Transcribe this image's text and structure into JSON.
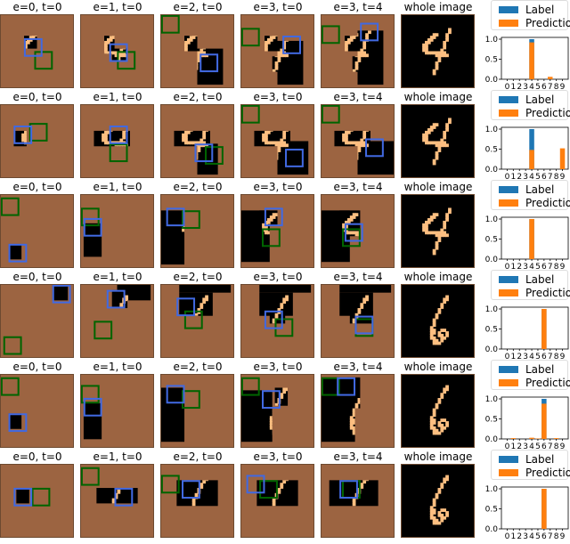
{
  "colors": {
    "canvas_brown": "#9c6441",
    "stroke_orange": "#fdbf81",
    "masked_black": "#000000",
    "glimpse_blue": "#4169e1",
    "glimpse_green": "#006400",
    "label_bar": "#1f77b4",
    "prediction_bar": "#ff7f0e"
  },
  "column_titles": [
    "e=0, t=0",
    "e=1, t=0",
    "e=2, t=0",
    "e=3, t=0",
    "e=3, t=4",
    "whole image"
  ],
  "legend": {
    "label": "Label",
    "prediction": "Prediction"
  },
  "rows": [
    {
      "digit": "4"
    },
    {
      "digit": "4"
    },
    {
      "digit": "4"
    },
    {
      "digit": "6"
    },
    {
      "digit": "6"
    },
    {
      "digit": "6"
    }
  ],
  "chart_data": [
    {
      "type": "bar",
      "title": "",
      "categories": [
        "0",
        "1",
        "2",
        "3",
        "4",
        "5",
        "6",
        "7",
        "8",
        "9"
      ],
      "series": [
        {
          "name": "Label",
          "values": [
            0,
            0,
            0,
            0,
            1,
            0,
            0,
            0,
            0,
            0
          ]
        },
        {
          "name": "Prediction",
          "values": [
            0,
            0,
            0,
            0,
            0.92,
            0,
            0,
            0.06,
            0,
            0
          ]
        }
      ],
      "ylim": [
        0,
        1.0
      ],
      "yticks": [
        "0.0",
        "0.5",
        "1.0"
      ],
      "legend": "top"
    },
    {
      "type": "bar",
      "title": "",
      "categories": [
        "0",
        "1",
        "2",
        "3",
        "4",
        "5",
        "6",
        "7",
        "8",
        "9"
      ],
      "series": [
        {
          "name": "Label",
          "values": [
            0,
            0,
            0,
            0,
            1,
            0,
            0,
            0,
            0,
            0
          ]
        },
        {
          "name": "Prediction",
          "values": [
            0,
            0,
            0,
            0,
            0.48,
            0,
            0,
            0,
            0,
            0.52
          ]
        }
      ],
      "ylim": [
        0,
        1.0
      ],
      "yticks": [
        "0.0",
        "0.5",
        "1.0"
      ],
      "legend": "top"
    },
    {
      "type": "bar",
      "title": "",
      "categories": [
        "0",
        "1",
        "2",
        "3",
        "4",
        "5",
        "6",
        "7",
        "8",
        "9"
      ],
      "series": [
        {
          "name": "Label",
          "values": [
            0,
            0,
            0,
            0,
            1,
            0,
            0,
            0,
            0,
            0
          ]
        },
        {
          "name": "Prediction",
          "values": [
            0,
            0,
            0,
            0,
            1.0,
            0,
            0,
            0,
            0,
            0
          ]
        }
      ],
      "ylim": [
        0,
        1.0
      ],
      "yticks": [
        "0.0",
        "0.5",
        "1.0"
      ],
      "legend": "top"
    },
    {
      "type": "bar",
      "title": "",
      "categories": [
        "0",
        "1",
        "2",
        "3",
        "4",
        "5",
        "6",
        "7",
        "8",
        "9"
      ],
      "series": [
        {
          "name": "Label",
          "values": [
            0,
            0,
            0,
            0,
            0,
            0,
            1,
            0,
            0,
            0
          ]
        },
        {
          "name": "Prediction",
          "values": [
            0,
            0,
            0,
            0,
            0,
            0,
            1.0,
            0,
            0,
            0
          ]
        }
      ],
      "ylim": [
        0,
        1.0
      ],
      "yticks": [
        "0.0",
        "0.5",
        "1.0"
      ],
      "legend": "top"
    },
    {
      "type": "bar",
      "title": "",
      "categories": [
        "0",
        "1",
        "2",
        "3",
        "4",
        "5",
        "6",
        "7",
        "8",
        "9"
      ],
      "series": [
        {
          "name": "Label",
          "values": [
            0,
            0,
            0,
            0,
            0,
            0,
            1,
            0,
            0,
            0
          ]
        },
        {
          "name": "Prediction",
          "values": [
            0,
            0.02,
            0,
            0,
            0.03,
            0.01,
            0.88,
            0,
            0.02,
            0
          ]
        }
      ],
      "ylim": [
        0,
        1.0
      ],
      "yticks": [
        "0.0",
        "0.5",
        "1.0"
      ],
      "legend": "top"
    },
    {
      "type": "bar",
      "title": "",
      "categories": [
        "0",
        "1",
        "2",
        "3",
        "4",
        "5",
        "6",
        "7",
        "8",
        "9"
      ],
      "series": [
        {
          "name": "Label",
          "values": [
            0,
            0,
            0,
            0,
            0,
            0,
            1,
            0,
            0,
            0
          ]
        },
        {
          "name": "Prediction",
          "values": [
            0,
            0,
            0,
            0,
            0,
            0,
            1.0,
            0,
            0,
            0
          ]
        }
      ],
      "ylim": [
        0,
        1.0
      ],
      "yticks": [
        "0.0",
        "0.5",
        "1.0"
      ],
      "legend": "top"
    }
  ]
}
